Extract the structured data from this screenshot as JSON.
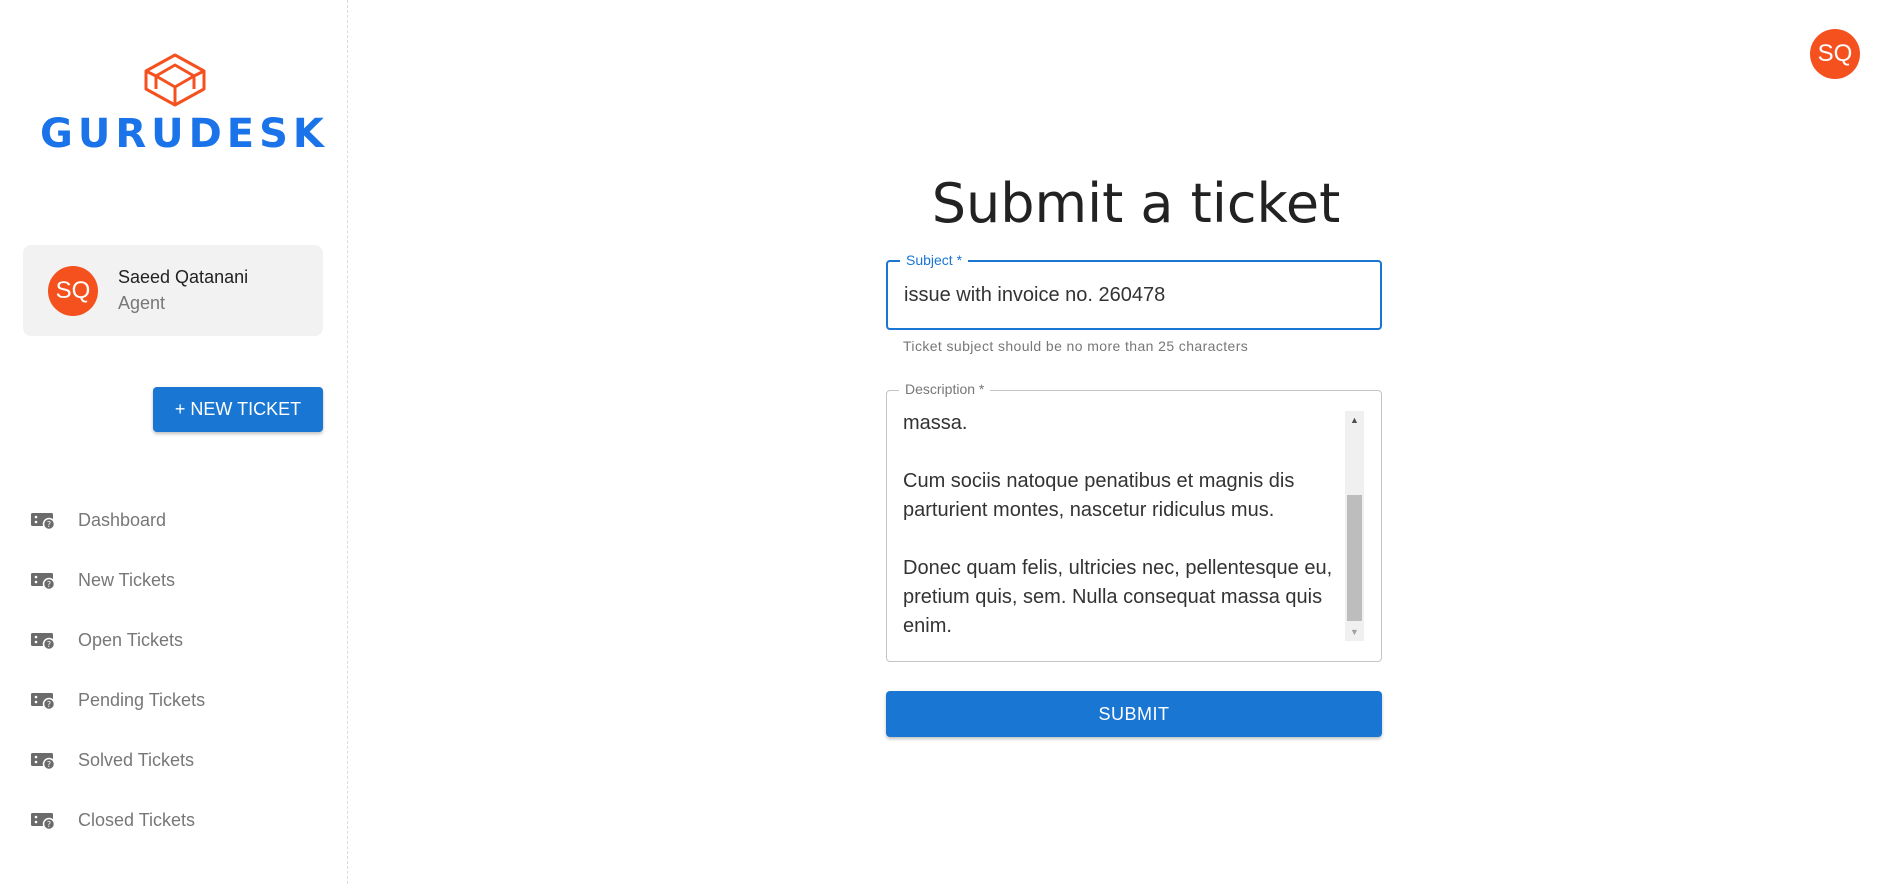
{
  "brand": {
    "name": "GURUDESK",
    "color": "#1a73e8",
    "logo_icon": "cube-icon",
    "logo_color": "#f4511e"
  },
  "user": {
    "initials": "SQ",
    "name": "Saeed Qatanani",
    "role": "Agent",
    "avatar_color": "#f4511e"
  },
  "sidebar": {
    "new_ticket_label": "+ NEW TICKET",
    "items": [
      {
        "label": "Dashboard",
        "icon": "ticket-icon"
      },
      {
        "label": "New Tickets",
        "icon": "ticket-icon"
      },
      {
        "label": "Open Tickets",
        "icon": "ticket-icon"
      },
      {
        "label": "Pending Tickets",
        "icon": "ticket-icon"
      },
      {
        "label": "Solved Tickets",
        "icon": "ticket-icon"
      },
      {
        "label": "Closed Tickets",
        "icon": "ticket-icon"
      }
    ]
  },
  "form": {
    "title": "Submit a ticket",
    "subject": {
      "label": "Subject *",
      "value": "issue with invoice no. 260478",
      "helper": "Ticket subject should be no more than 25 characters"
    },
    "description": {
      "label": "Description *",
      "visible_lines": [
        "massa.",
        "Cum sociis natoque penatibus et magnis dis parturient montes, nascetur ridiculus mus.",
        "Donec quam felis, ultricies nec, pellentesque eu, pretium quis, sem. Nulla consequat massa quis enim."
      ]
    },
    "submit_label": "SUBMIT",
    "accent_color": "#1976d2"
  }
}
